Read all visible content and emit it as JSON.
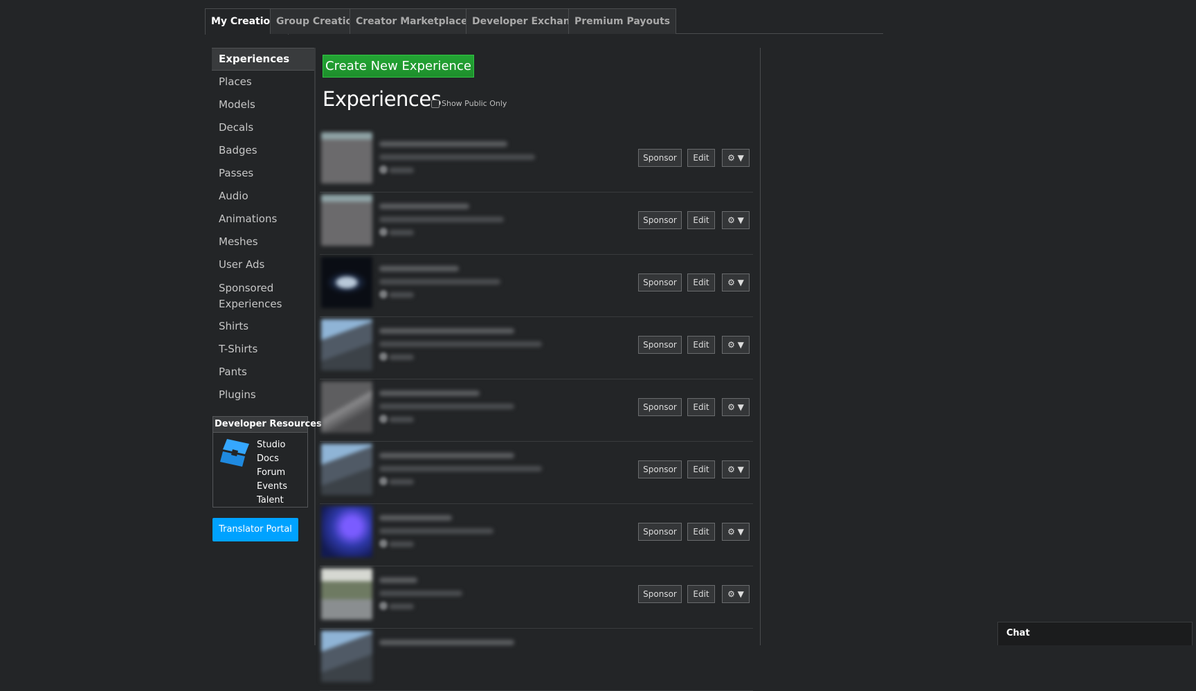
{
  "tabs": [
    {
      "label": "My Creations",
      "active": true
    },
    {
      "label": "Group Creations",
      "active": false
    },
    {
      "label": "Creator Marketplace",
      "active": false
    },
    {
      "label": "Developer Exchange",
      "active": false
    },
    {
      "label": "Premium Payouts",
      "active": false
    }
  ],
  "sidebar": {
    "items": [
      {
        "label": "Experiences",
        "active": true
      },
      {
        "label": "Places"
      },
      {
        "label": "Models"
      },
      {
        "label": "Decals"
      },
      {
        "label": "Badges"
      },
      {
        "label": "Passes"
      },
      {
        "label": "Audio"
      },
      {
        "label": "Animations"
      },
      {
        "label": "Meshes"
      },
      {
        "label": "User Ads"
      },
      {
        "label": "Sponsored Experiences"
      },
      {
        "label": "Shirts"
      },
      {
        "label": "T-Shirts"
      },
      {
        "label": "Pants"
      },
      {
        "label": "Plugins"
      }
    ],
    "developer_resources": {
      "title": "Developer Resources",
      "links": [
        "Studio",
        "Docs",
        "Forum",
        "Events",
        "Talent"
      ],
      "logo_icon": "roblox-studio-icon"
    },
    "translator_button": "Translator Portal"
  },
  "main": {
    "create_button": "Create New Experience",
    "title": "Experiences",
    "show_public_only_label": "Show Public Only",
    "show_public_only_checked": false,
    "row_buttons": {
      "sponsor": "Sponsor",
      "edit": "Edit",
      "gear": "⚙ ▼"
    },
    "experiences_count_visible": 9
  },
  "chat": {
    "label": "Chat"
  },
  "colors": {
    "background": "#232527",
    "create_button": "#1e8f2c",
    "translator_button": "#00a2ff",
    "text_primary": "#ffffff"
  }
}
